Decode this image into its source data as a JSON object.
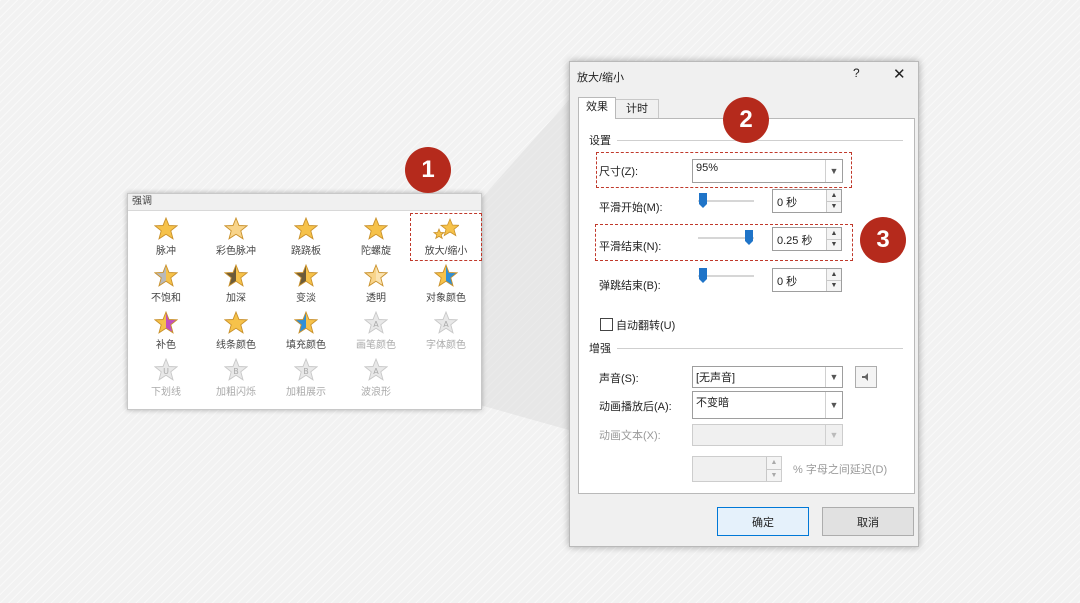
{
  "gallery": {
    "header": "强调",
    "effects": [
      {
        "label": "脉冲",
        "icon": "star-pulse-icon"
      },
      {
        "label": "彩色脉冲",
        "icon": "star-color-pulse-icon"
      },
      {
        "label": "跷跷板",
        "icon": "star-teeter-icon"
      },
      {
        "label": "陀螺旋",
        "icon": "star-spin-icon"
      },
      {
        "label": "放大/缩小",
        "icon": "star-grow-shrink-icon"
      },
      {
        "label": "不饱和",
        "icon": "star-desaturate-icon"
      },
      {
        "label": "加深",
        "icon": "star-darken-icon"
      },
      {
        "label": "变淡",
        "icon": "star-lighten-icon"
      },
      {
        "label": "透明",
        "icon": "star-transparency-icon"
      },
      {
        "label": "对象颜色",
        "icon": "star-object-color-icon"
      },
      {
        "label": "补色",
        "icon": "star-complementary-color-icon"
      },
      {
        "label": "线条颜色",
        "icon": "star-line-color-icon"
      },
      {
        "label": "填充颜色",
        "icon": "star-fill-color-icon"
      },
      {
        "label": "画笔颜色",
        "icon": "star-brush-color-icon"
      },
      {
        "label": "字体颜色",
        "icon": "star-font-color-icon"
      },
      {
        "label": "下划线",
        "icon": "star-underline-icon"
      },
      {
        "label": "加粗闪烁",
        "icon": "star-bold-flash-icon"
      },
      {
        "label": "加粗展示",
        "icon": "star-bold-reveal-icon"
      },
      {
        "label": "波浪形",
        "icon": "star-wave-icon"
      }
    ]
  },
  "dialog": {
    "title": "放大/缩小",
    "help": "?",
    "close": "✕",
    "tabs": [
      {
        "label": "效果"
      },
      {
        "label": "计时"
      }
    ],
    "settings": {
      "group_label": "设置",
      "size_label": "尺寸(Z):",
      "size_value": "95%",
      "smooth_start_label": "平滑开始(M):",
      "smooth_start_value": "0 秒",
      "smooth_start_level": 0,
      "smooth_end_label": "平滑结束(N):",
      "smooth_end_value": "0.25 秒",
      "smooth_end_level": 0.25,
      "bounce_end_label": "弹跳结束(B):",
      "bounce_end_value": "0 秒",
      "bounce_end_level": 0,
      "auto_reverse_label": "自动翻转(U)",
      "auto_reverse_checked": false
    },
    "enhancements": {
      "group_label": "增强",
      "sound_label": "声音(S):",
      "sound_value": "[无声音]",
      "after_anim_label": "动画播放后(A):",
      "after_anim_value": "不变暗",
      "animate_text_label": "动画文本(X):",
      "animate_text_value": "",
      "delay_value": "",
      "delay_label": "% 字母之间延迟(D)"
    },
    "ok_label": "确定",
    "cancel_label": "取消"
  },
  "callouts": [
    "1",
    "2",
    "3"
  ],
  "colors": {
    "accent": "#b52a1c",
    "highlight_border": "#c0392b",
    "slider_thumb": "#1f74c8",
    "ok_border": "#0078d7"
  }
}
